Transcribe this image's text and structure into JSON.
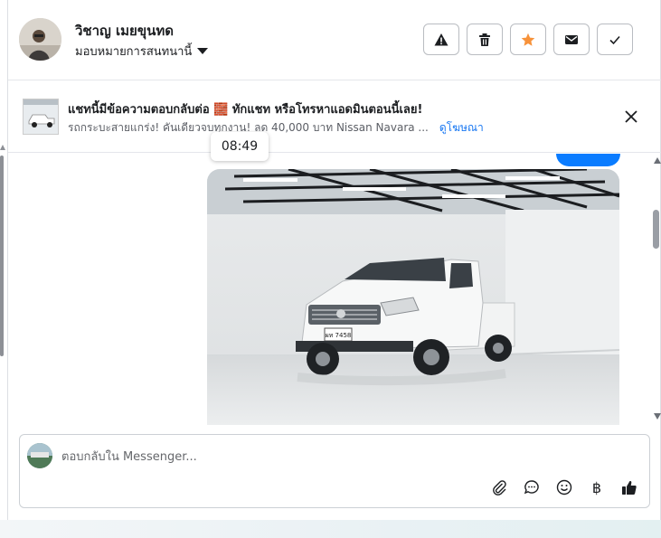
{
  "header": {
    "contact_name": "วิชาญ เมยขุนทด",
    "assign_label": "มอบหมายการสนทนานี้",
    "actions": [
      {
        "name": "report-button",
        "icon": "warning-icon"
      },
      {
        "name": "delete-button",
        "icon": "trash-icon"
      },
      {
        "name": "star-button",
        "icon": "star-icon",
        "color": "#f7923a"
      },
      {
        "name": "mark-unread-button",
        "icon": "envelope-icon"
      },
      {
        "name": "mark-done-button",
        "icon": "check-icon"
      }
    ]
  },
  "ad": {
    "title": "แชทนี้มีข้อความตอบกลับต่อ 🧱 ทักแชท หรือโทรหาแอดมินตอนนี้เลย!",
    "subtitle": "รถกระบะสายแกร่ง! คันเดียวจบทุกงาน! ลด 40,000 บาท Nissan Navara ...",
    "link_label": "ดูโฆษณา"
  },
  "chat": {
    "timestamp": "08:49",
    "plate_text": "ผท 7458"
  },
  "composer": {
    "placeholder": "ตอบกลับใน Messenger...",
    "tools": [
      "paperclip-icon",
      "chat-bubble-icon",
      "smiley-icon",
      "baht-icon",
      "thumbs-up-icon"
    ],
    "baht_symbol": "฿"
  },
  "colors": {
    "accent": "#0a7cff",
    "star": "#f7923a",
    "link": "#1877f2"
  }
}
